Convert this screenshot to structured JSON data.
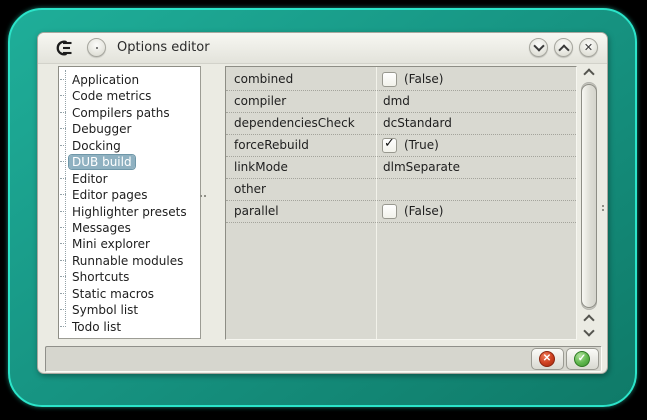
{
  "window": {
    "title": "Options editor",
    "titlebar_buttons": [
      "minimize",
      "maximize",
      "close"
    ]
  },
  "sidebar": {
    "items": [
      "Application",
      "Code metrics",
      "Compilers paths",
      "Debugger",
      "Docking",
      "DUB build",
      "Editor",
      "Editor pages",
      "Highlighter presets",
      "Messages",
      "Mini explorer",
      "Runnable modules",
      "Shortcuts",
      "Static macros",
      "Symbol list",
      "Todo list"
    ],
    "selected_index": 5,
    "selected_label": "DUB build"
  },
  "grid": {
    "rows": [
      {
        "name": "combined",
        "type": "bool",
        "checked": false,
        "display": "(False)"
      },
      {
        "name": "compiler",
        "type": "text",
        "display": "dmd"
      },
      {
        "name": "dependenciesCheck",
        "type": "text",
        "display": "dcStandard"
      },
      {
        "name": "forceRebuild",
        "type": "bool",
        "checked": true,
        "display": "(True)"
      },
      {
        "name": "linkMode",
        "type": "text",
        "display": "dlmSeparate"
      },
      {
        "name": "other",
        "type": "text",
        "display": ""
      },
      {
        "name": "parallel",
        "type": "bool",
        "checked": false,
        "display": "(False)"
      }
    ]
  },
  "footer": {
    "buttons": [
      {
        "name": "cancel",
        "icon": "red-cross-icon"
      },
      {
        "name": "accept",
        "icon": "green-check-icon"
      }
    ]
  },
  "glyphs": {
    "checkmark": "✓",
    "cross": "✕",
    "close": "✕"
  },
  "colors": {
    "frame_teal": "#179684",
    "frame_edge": "#2be4c9",
    "window_bg": "#ebebe3",
    "grid_bg": "#d9d9d1",
    "selection": "#8fb1c1",
    "cancel_red": "#cd3f1f",
    "accept_green": "#5eb64c"
  }
}
